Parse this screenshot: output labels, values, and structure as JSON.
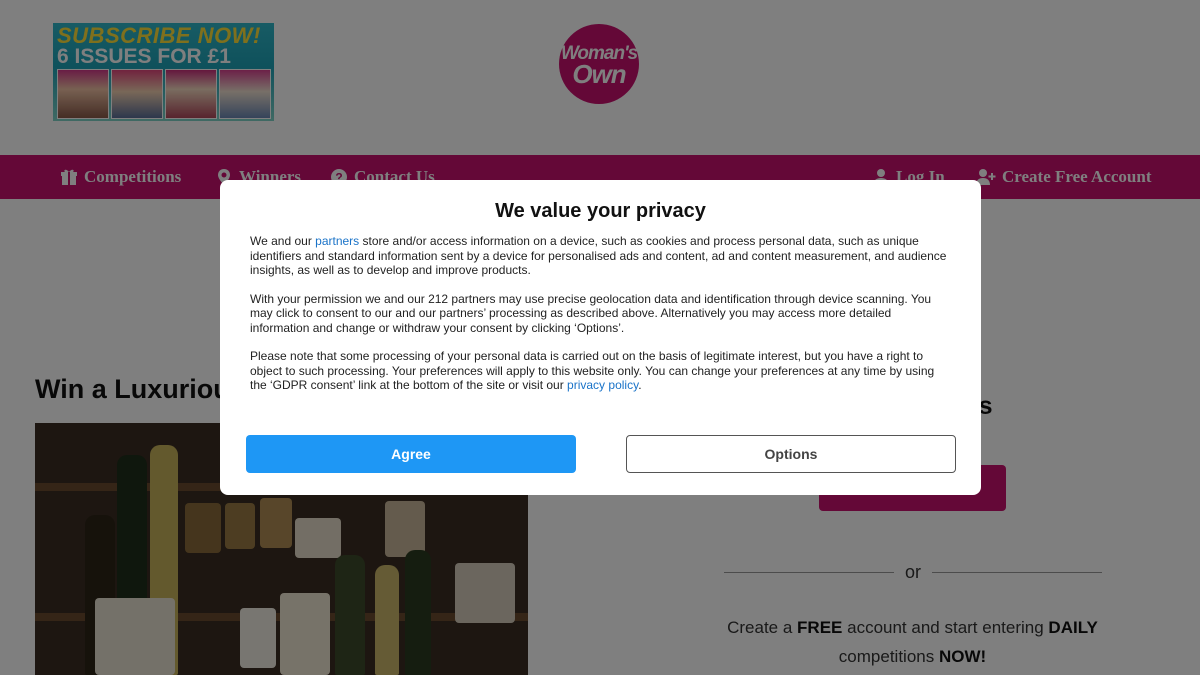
{
  "promo": {
    "headline": "SUBSCRIBE NOW!",
    "offer": "6 ISSUES FOR £1"
  },
  "logo": {
    "line1": "Woman's",
    "line2": "Own"
  },
  "nav": {
    "items": [
      {
        "label": "Competitions",
        "icon": "gift-icon"
      },
      {
        "label": "Winners",
        "icon": "map-pin-icon"
      },
      {
        "label": "Contact Us",
        "icon": "question-icon"
      }
    ],
    "right_items": [
      {
        "label": "Log In",
        "icon": "user-icon"
      },
      {
        "label": "Create Free Account",
        "icon": "user-plus-icon"
      }
    ]
  },
  "content": {
    "title": "Win a Luxurious",
    "side_heading": "ers"
  },
  "signup": {
    "or_text": "or",
    "create_prefix": "Create a ",
    "create_free": "FREE",
    "create_middle": " account and start entering ",
    "create_daily": "DAILY",
    "create_comp": "competitions ",
    "create_now": "NOW!"
  },
  "consent": {
    "title": "We value your privacy",
    "p1_before": "We and our ",
    "p1_link": "partners",
    "p1_after": " store and/or access information on a device, such as cookies and process personal data, such as unique identifiers and standard information sent by a device for personalised ads and content, ad and content measurement, and audience insights, as well as to develop and improve products.",
    "p2": "With your permission we and our 212 partners may use precise geolocation data and identification through device scanning. You may click to consent to our and our partners’ processing as described above. Alternatively you may access more detailed information and change or withdraw your consent by clicking ‘Options’.",
    "p3_before": "Please note that some processing of your personal data is carried out on the basis of legitimate interest, but you have a right to object to such processing. Your preferences will apply to this website only. You can change your preferences at any time by using the ‘GDPR consent’ link at the bottom of the site or visit our ",
    "p3_link": "privacy policy",
    "p3_after": ".",
    "agree_label": "Agree",
    "options_label": "Options"
  },
  "colors": {
    "brand": "#c8106f",
    "agree": "#1e97f5",
    "link": "#1a73c8"
  }
}
